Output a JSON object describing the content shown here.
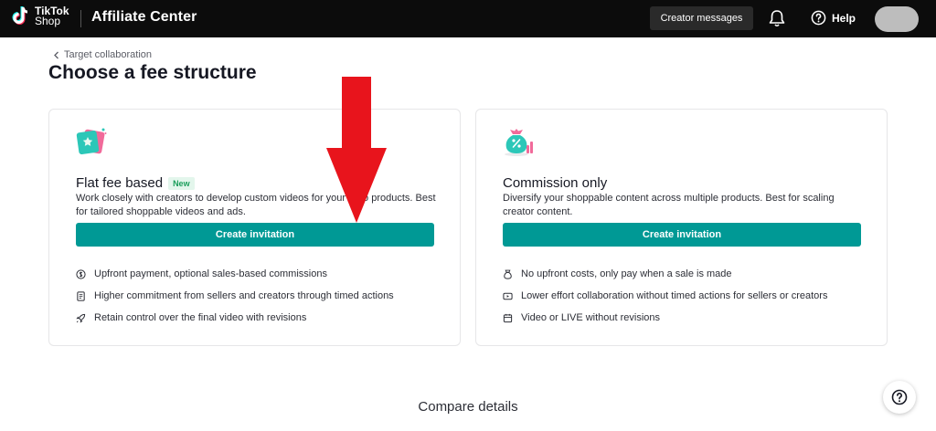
{
  "header": {
    "logo_line1": "TikTok",
    "logo_line2": "Shop",
    "app_title": "Affiliate Center",
    "creator_messages": "Creator messages",
    "help": "Help"
  },
  "breadcrumb": "Target collaboration",
  "page_title": "Choose a fee structure",
  "cards": [
    {
      "title": "Flat fee based",
      "badge": "New",
      "description": "Work closely with creators to develop custom videos for your hero products. Best for tailored shoppable videos and ads.",
      "cta": "Create invitation",
      "features": [
        {
          "icon": "dollar-icon",
          "text": "Upfront payment, optional sales-based commissions"
        },
        {
          "icon": "document-icon",
          "text": "Higher commitment from sellers and creators through timed actions"
        },
        {
          "icon": "rocket-icon",
          "text": "Retain control over the final video with revisions"
        }
      ]
    },
    {
      "title": "Commission only",
      "badge": "",
      "description": "Diversify your shoppable content across multiple products. Best for scaling creator content.",
      "cta": "Create invitation",
      "features": [
        {
          "icon": "money-bag-icon",
          "text": "No upfront costs, only pay when a sale is made"
        },
        {
          "icon": "video-icon",
          "text": "Lower effort collaboration without timed actions for sellers or creators"
        },
        {
          "icon": "calendar-icon",
          "text": "Video or LIVE without revisions"
        }
      ]
    }
  ],
  "compare_details": "Compare details",
  "colors": {
    "accent": "#009995",
    "topbar": "#0c0c0c",
    "arrow": "#e8141c",
    "badge_green": "#1a9e5b"
  }
}
